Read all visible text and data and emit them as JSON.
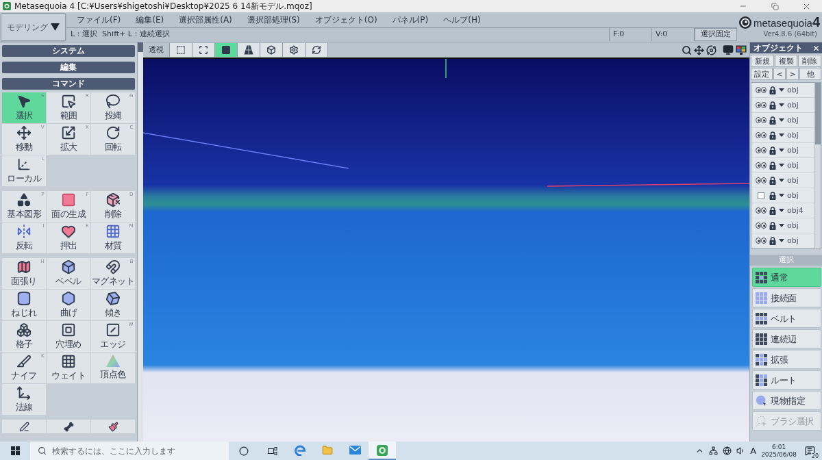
{
  "window": {
    "title": "Metasequoia 4 [C:¥Users¥shigetoshi¥Desktop¥2025 6 14新モデル.mqoz]"
  },
  "mode_selector": {
    "label": "モデリング"
  },
  "menu": [
    "ファイル(F)",
    "編集(E)",
    "選択部属性(A)",
    "選択部処理(S)",
    "オブジェクト(O)",
    "パネル(P)",
    "ヘルプ(H)"
  ],
  "status_bar": {
    "hint": "L：選択  Shift+ L：連続選択",
    "faces": "F:0",
    "vertices": "V:0",
    "lock_button": "選択固定"
  },
  "logo": {
    "wordmark": "metasequoia",
    "edition": "4",
    "version": "Ver4.8.6 (64bit)"
  },
  "view_toolbar": {
    "perspective": "透視",
    "tools": [
      {
        "selected": false
      },
      {
        "selected": false
      },
      {
        "selected": true
      },
      {
        "selected": false
      },
      {
        "selected": false
      },
      {
        "selected": false
      },
      {
        "selected": false
      }
    ]
  },
  "command_panel": {
    "sections": [
      "システム",
      "編集"
    ],
    "title": "コマンド",
    "tool_groups": [
      [
        {
          "label": "選択",
          "shortcut": "S",
          "selected": true
        },
        {
          "label": "範囲",
          "shortcut": "R",
          "selected": false
        },
        {
          "label": "投縄",
          "shortcut": "G",
          "selected": false
        },
        {
          "label": "移動",
          "shortcut": "V",
          "selected": false
        },
        {
          "label": "拡大",
          "shortcut": "X",
          "selected": false
        },
        {
          "label": "回転",
          "shortcut": "C",
          "selected": false
        },
        {
          "label": "ローカル",
          "shortcut": "L",
          "selected": false
        }
      ],
      [
        {
          "label": "基本図形",
          "shortcut": "P",
          "selected": false
        },
        {
          "label": "面の生成",
          "shortcut": "F",
          "selected": false
        },
        {
          "label": "削除",
          "shortcut": "D",
          "selected": false
        },
        {
          "label": "反転",
          "shortcut": "I",
          "selected": false
        },
        {
          "label": "押出",
          "shortcut": "E",
          "selected": false
        },
        {
          "label": "材質",
          "shortcut": "M",
          "selected": false
        }
      ],
      [
        {
          "label": "面張り",
          "shortcut": "H",
          "selected": false
        },
        {
          "label": "ベベル",
          "selected": false
        },
        {
          "label": "マグネット",
          "shortcut": "B",
          "selected": false
        },
        {
          "label": "ねじれ",
          "selected": false
        },
        {
          "label": "曲げ",
          "selected": false
        },
        {
          "label": "傾き",
          "selected": false
        },
        {
          "label": "格子",
          "selected": false
        },
        {
          "label": "穴埋め",
          "selected": false
        },
        {
          "label": "エッジ",
          "shortcut": "W",
          "selected": false
        },
        {
          "label": "ナイフ",
          "shortcut": "K",
          "selected": false
        },
        {
          "label": "ウェイト",
          "selected": false
        },
        {
          "label": "頂点色",
          "selected": false
        },
        {
          "label": "法線",
          "selected": false
        }
      ]
    ]
  },
  "object_panel": {
    "title": "オブジェクト",
    "buttons": [
      "新規",
      "複製",
      "削除"
    ],
    "buttons_row_2": [
      "設定",
      "<",
      ">",
      "他"
    ],
    "items": [
      {
        "name": "obj",
        "visible": true
      },
      {
        "name": "obj",
        "visible": true
      },
      {
        "name": "obj",
        "visible": true
      },
      {
        "name": "obj",
        "visible": true
      },
      {
        "name": "obj",
        "visible": true
      },
      {
        "name": "obj",
        "visible": true
      },
      {
        "name": "obj",
        "visible": true
      },
      {
        "name": "obj",
        "visible": false
      },
      {
        "name": "obj4",
        "visible": true
      },
      {
        "name": "obj",
        "visible": true
      },
      {
        "name": "obj",
        "visible": true
      }
    ]
  },
  "selection_panel": {
    "title": "選択",
    "modes": [
      {
        "label": "通常",
        "selected": true,
        "disabled": false
      },
      {
        "label": "接続面",
        "selected": false,
        "disabled": false
      },
      {
        "label": "ベルト",
        "selected": false,
        "disabled": false
      },
      {
        "label": "連続辺",
        "selected": false,
        "disabled": false
      },
      {
        "label": "拡張",
        "selected": false,
        "disabled": false
      },
      {
        "label": "ルート",
        "selected": false,
        "disabled": false
      },
      {
        "label": "現物指定",
        "selected": false,
        "disabled": false
      },
      {
        "label": "ブラシ選択",
        "selected": false,
        "disabled": true
      }
    ]
  },
  "taskbar": {
    "search": {
      "placeholder": "検索するには、ここに入力します"
    },
    "apps": [
      {
        "selected": false
      },
      {
        "selected": false
      },
      {
        "selected": false
      },
      {
        "selected": true
      }
    ],
    "ime": "A",
    "time": "6:01",
    "date": "2025/06/08",
    "notifications": "20"
  }
}
